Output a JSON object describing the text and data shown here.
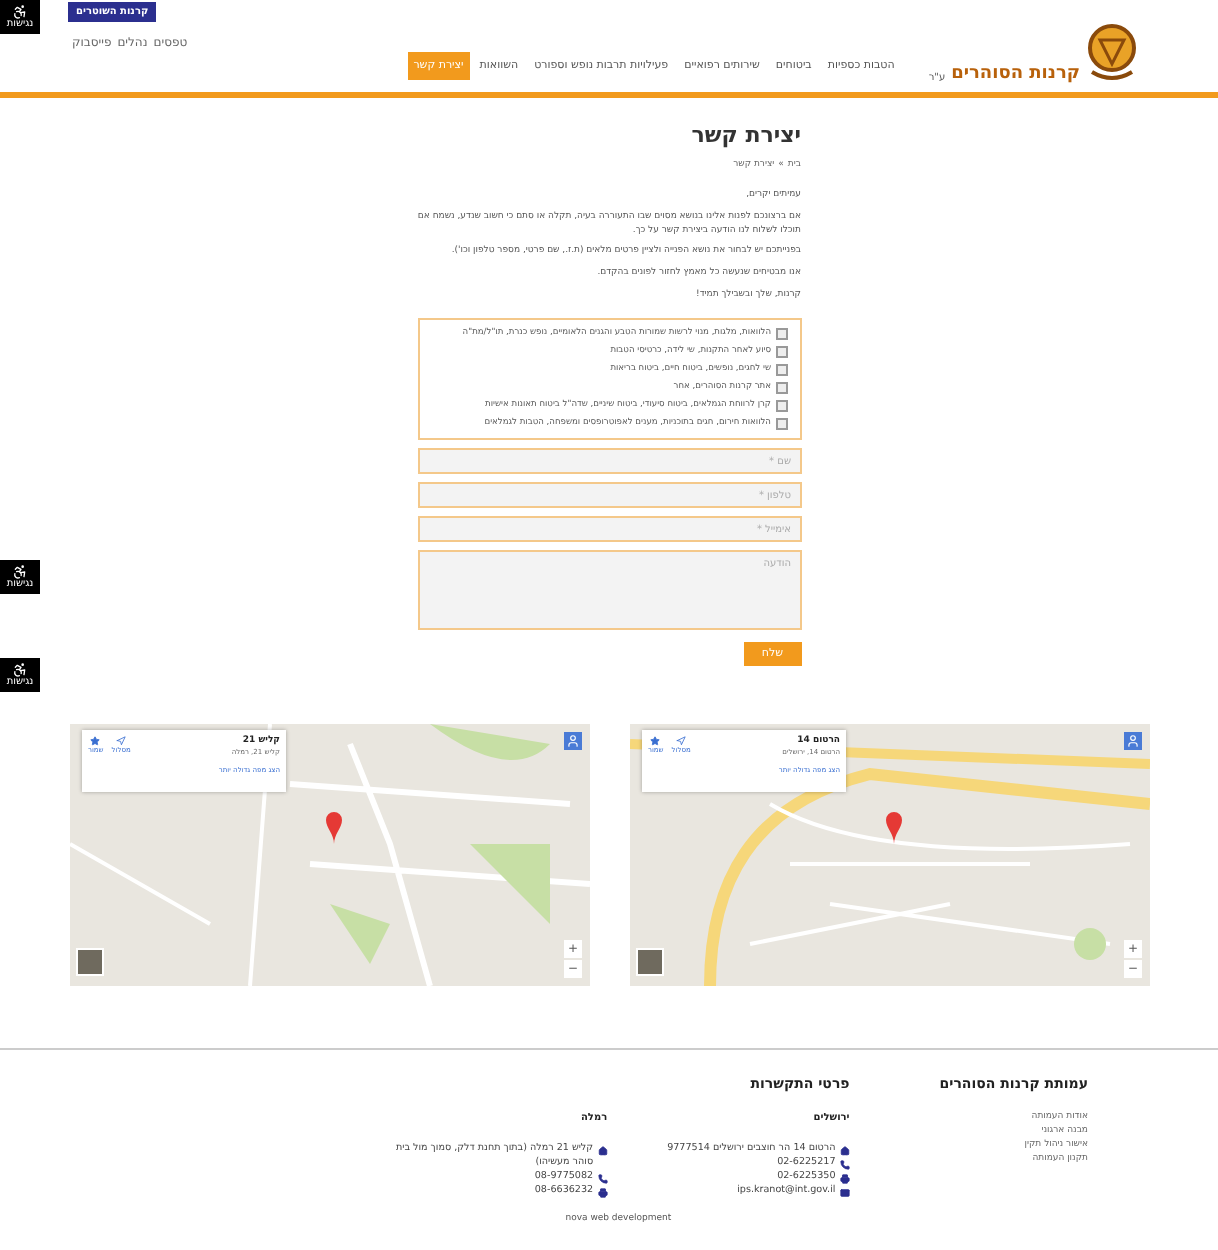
{
  "accessibility_buttons": [
    {
      "label": "נגישות"
    },
    {
      "label": "נגישות"
    },
    {
      "label": "נגישות"
    }
  ],
  "header": {
    "badge": "קרנות השוטרים",
    "top_links": [
      "טפסים",
      "נהלים",
      "פייסבוק"
    ],
    "logo": {
      "name": "קרנות הסוהרים",
      "suffix": "ע\"ר"
    }
  },
  "nav": [
    {
      "label": "הטבות כספיות",
      "selected": false
    },
    {
      "label": "ביטוחים",
      "selected": false
    },
    {
      "label": "שירותים רפואיים",
      "selected": false
    },
    {
      "label": "פעילויות תרבות נופש וספורט",
      "selected": false
    },
    {
      "label": "השוואות",
      "selected": false
    },
    {
      "label": "יצירת קשר",
      "selected": true
    }
  ],
  "page": {
    "title": "יצירת קשר",
    "breadcrumb": [
      "בית",
      "יצירת קשר"
    ],
    "breadcrumb_separator": "»",
    "paragraphs": [
      "עמיתים יקרים,",
      "אם ברצונכם לפנות אלינו בנושא מסוים שבו התעוררה בעיה, תקלה או סתם כי חשוב שנדע, נשמח אם תוכלו לשלוח לנו הודעה ביצירת קשר על כך.",
      "בפנייתכם יש לבחור את נושא הפנייה ולציין פרטים מלאים (ת.ז., שם פרטי, מספר טלפון וכו').",
      "אנו מבטיחים שנעשה כל מאמץ לחזור לפונים בהקדם.",
      "קרנות, שלך ובשבילך תמיד!"
    ],
    "topics": [
      {
        "label": "הלוואות, מלגות, מנוי לרשות שמורות הטבע והגנים הלאומיים, נופש כנרת, תו\"ל/מת\"ה",
        "checked": false
      },
      {
        "label": "סיוע לאחר התקנות, שי לידה, כרטיסי הטבות",
        "checked": false
      },
      {
        "label": "שי לחגים, נופשים, ביטוח חיים, ביטוח בריאות",
        "checked": false
      },
      {
        "label": "אתר קרנות הסוהרים, אחר",
        "checked": false
      },
      {
        "label": "קרן לרווחת הגמלאים, ביטוח סיעודי, ביטוח שיניים, שדה\"ל ביטוח תאונות אישיות",
        "checked": false
      },
      {
        "label": "הלוואות חירום, חגים בתוכניות, מענים לאפוטרופסים ומשפחה, הטבות לגמלאים",
        "checked": false
      }
    ],
    "fields": [
      {
        "kind": "input",
        "placeholder": "שם *"
      },
      {
        "kind": "input",
        "placeholder": "טלפון *"
      },
      {
        "kind": "input",
        "placeholder": "אימייל *"
      },
      {
        "kind": "textarea",
        "placeholder": "הודעה"
      }
    ],
    "submit": "שלח"
  },
  "maps": [
    {
      "title": "הרטום 14",
      "address": "הרטום 14, ירושלים",
      "link": "הצג מפה גדולה יותר",
      "actions": [
        "מסלול",
        "שמור"
      ],
      "zoom": [
        "+",
        "−"
      ]
    },
    {
      "title": "קליש 21",
      "address": "קליש 21, רמלה",
      "link": "הצג מפה גדולה יותר",
      "actions": [
        "מסלול",
        "שמור"
      ],
      "zoom": [
        "+",
        "−"
      ]
    }
  ],
  "footer": {
    "about": {
      "title": "עמותת קרנות הסוהרים",
      "links": [
        "אודות העמותה",
        "מבנה ארגוני",
        "אישור ניהול תקין",
        "תקנון העמותה"
      ]
    },
    "contact": {
      "title": "פרטי התקשרות",
      "offices": [
        {
          "city": "ירושלים",
          "lines": [
            {
              "kind": "address",
              "text": "הרטום 14 הר חוצבים ירושלים 9777514"
            },
            {
              "kind": "phone",
              "text": "02-6225217"
            },
            {
              "kind": "fax",
              "text": "02-6225350"
            },
            {
              "kind": "email",
              "text": "ips.kranot@int.gov.il"
            }
          ]
        },
        {
          "city": "רמלה",
          "lines": [
            {
              "kind": "address",
              "text": "קליש 21 רמלה (בתוך תחנת דלק, סמוך מול בית סוהר מעשיהו)"
            },
            {
              "kind": "phone",
              "text": "08-9775082"
            },
            {
              "kind": "fax",
              "text": "08-6636232"
            }
          ]
        }
      ]
    },
    "credit": "nova web development"
  }
}
